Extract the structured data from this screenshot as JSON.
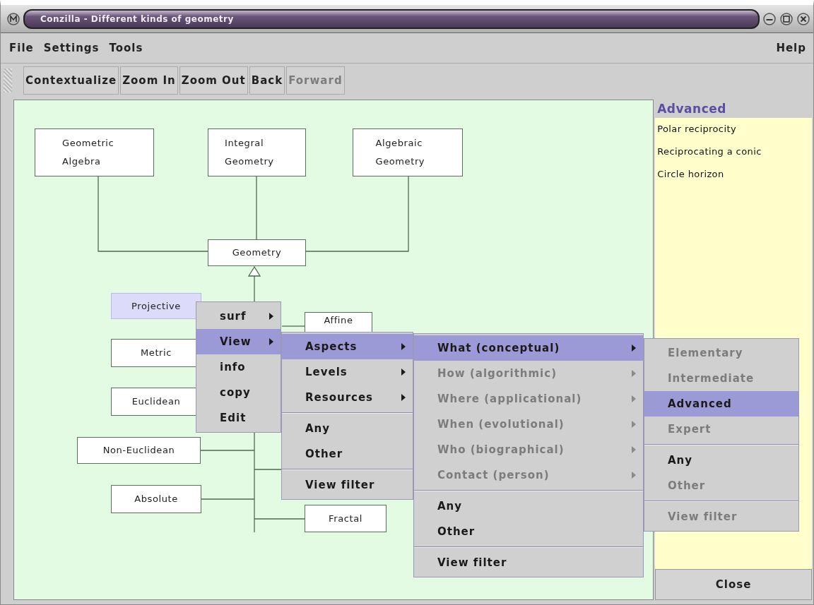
{
  "window": {
    "title": "Conzilla - Different kinds of geometry"
  },
  "menu_bar": {
    "left": [
      "File",
      "Settings",
      "Tools"
    ],
    "right": [
      "Help"
    ]
  },
  "toolbar": [
    {
      "label": "Contextualize",
      "disabled": false
    },
    {
      "label": "Zoom In",
      "disabled": false
    },
    {
      "label": "Zoom Out",
      "disabled": false
    },
    {
      "label": "Back",
      "disabled": false
    },
    {
      "label": "Forward",
      "disabled": true
    }
  ],
  "diagram": {
    "nodes": [
      {
        "label": "Geometric Algebra",
        "selected": false
      },
      {
        "label": "Integral Geometry",
        "selected": false
      },
      {
        "label": "Algebraic Geometry",
        "selected": false
      },
      {
        "label": "Geometry",
        "selected": false
      },
      {
        "label": "Projective",
        "selected": true
      },
      {
        "label": "Affine",
        "selected": false
      },
      {
        "label": "Metric",
        "selected": false
      },
      {
        "label": "Euclidean",
        "selected": false
      },
      {
        "label": "Non-Euclidean",
        "selected": false
      },
      {
        "label": "Absolute",
        "selected": false
      },
      {
        "label": "Fractal",
        "selected": false
      }
    ]
  },
  "context_menus": [
    {
      "sections": [
        [
          {
            "label": "surf",
            "submenu": true,
            "selected": false,
            "disabled": false
          },
          {
            "label": "View",
            "submenu": true,
            "selected": true,
            "disabled": false
          },
          {
            "label": "info",
            "submenu": false,
            "selected": false,
            "disabled": false
          },
          {
            "label": "copy",
            "submenu": false,
            "selected": false,
            "disabled": false
          },
          {
            "label": "Edit",
            "submenu": false,
            "selected": false,
            "disabled": false
          }
        ]
      ]
    },
    {
      "sections": [
        [
          {
            "label": "Aspects",
            "submenu": true,
            "selected": true,
            "disabled": false
          },
          {
            "label": "Levels",
            "submenu": true,
            "selected": false,
            "disabled": false
          },
          {
            "label": "Resources",
            "submenu": true,
            "selected": false,
            "disabled": false
          }
        ],
        [
          {
            "label": "Any",
            "submenu": false,
            "selected": false,
            "disabled": false
          },
          {
            "label": "Other",
            "submenu": false,
            "selected": false,
            "disabled": false
          }
        ],
        [
          {
            "label": "View filter",
            "submenu": false,
            "selected": false,
            "disabled": false
          }
        ]
      ]
    },
    {
      "sections": [
        [
          {
            "label": "What (conceptual)",
            "submenu": true,
            "selected": true,
            "disabled": false
          },
          {
            "label": "How (algorithmic)",
            "submenu": true,
            "selected": false,
            "disabled": true
          },
          {
            "label": "Where (applicational)",
            "submenu": true,
            "selected": false,
            "disabled": true
          },
          {
            "label": "When (evolutional)",
            "submenu": true,
            "selected": false,
            "disabled": true
          },
          {
            "label": "Who (biographical)",
            "submenu": true,
            "selected": false,
            "disabled": true
          },
          {
            "label": "Contact (person)",
            "submenu": true,
            "selected": false,
            "disabled": true
          }
        ],
        [
          {
            "label": "Any",
            "submenu": false,
            "selected": false,
            "disabled": false
          },
          {
            "label": "Other",
            "submenu": false,
            "selected": false,
            "disabled": false
          }
        ],
        [
          {
            "label": "View filter",
            "submenu": false,
            "selected": false,
            "disabled": false
          }
        ]
      ]
    },
    {
      "sections": [
        [
          {
            "label": "Elementary",
            "submenu": false,
            "selected": false,
            "disabled": true
          },
          {
            "label": "Intermediate",
            "submenu": false,
            "selected": false,
            "disabled": true
          },
          {
            "label": "Advanced",
            "submenu": false,
            "selected": true,
            "disabled": false
          },
          {
            "label": "Expert",
            "submenu": false,
            "selected": false,
            "disabled": true
          }
        ],
        [
          {
            "label": "Any",
            "submenu": false,
            "selected": false,
            "disabled": false
          },
          {
            "label": "Other",
            "submenu": false,
            "selected": false,
            "disabled": true
          }
        ],
        [
          {
            "label": "View filter",
            "submenu": false,
            "selected": false,
            "disabled": true
          }
        ]
      ]
    }
  ],
  "side_panel": {
    "heading": "Advanced",
    "items": [
      "Polar reciprocity",
      "Reciprocating a conic",
      "Circle horizon"
    ],
    "close_button": "Close"
  }
}
